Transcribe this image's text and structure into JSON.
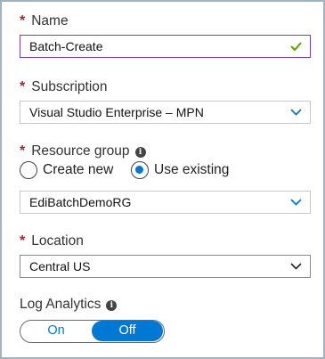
{
  "name_section": {
    "required_mark": "*",
    "label": "Name",
    "value": "Batch-Create"
  },
  "subscription_section": {
    "required_mark": "*",
    "label": "Subscription",
    "value": "Visual Studio Enterprise – MPN"
  },
  "resource_group_section": {
    "required_mark": "*",
    "label": "Resource group",
    "info_glyph": "i",
    "options": [
      "Create new",
      "Use existing"
    ],
    "selected_option": "Use existing",
    "value": "EdiBatchDemoRG"
  },
  "location_section": {
    "required_mark": "*",
    "label": "Location",
    "value": "Central US"
  },
  "log_analytics_section": {
    "label": "Log Analytics",
    "info_glyph": "i",
    "toggle_on_label": "On",
    "toggle_off_label": "Off",
    "selected": "Off"
  },
  "colors": {
    "accent": "#0078d4",
    "required": "#a4262c",
    "valid_check": "#57a300",
    "active_border": "#7b3fa6"
  },
  "icons": {
    "valid": "check-icon",
    "dropdown_accent": "chevron-down-icon",
    "dropdown_plain": "chevron-down-icon"
  }
}
